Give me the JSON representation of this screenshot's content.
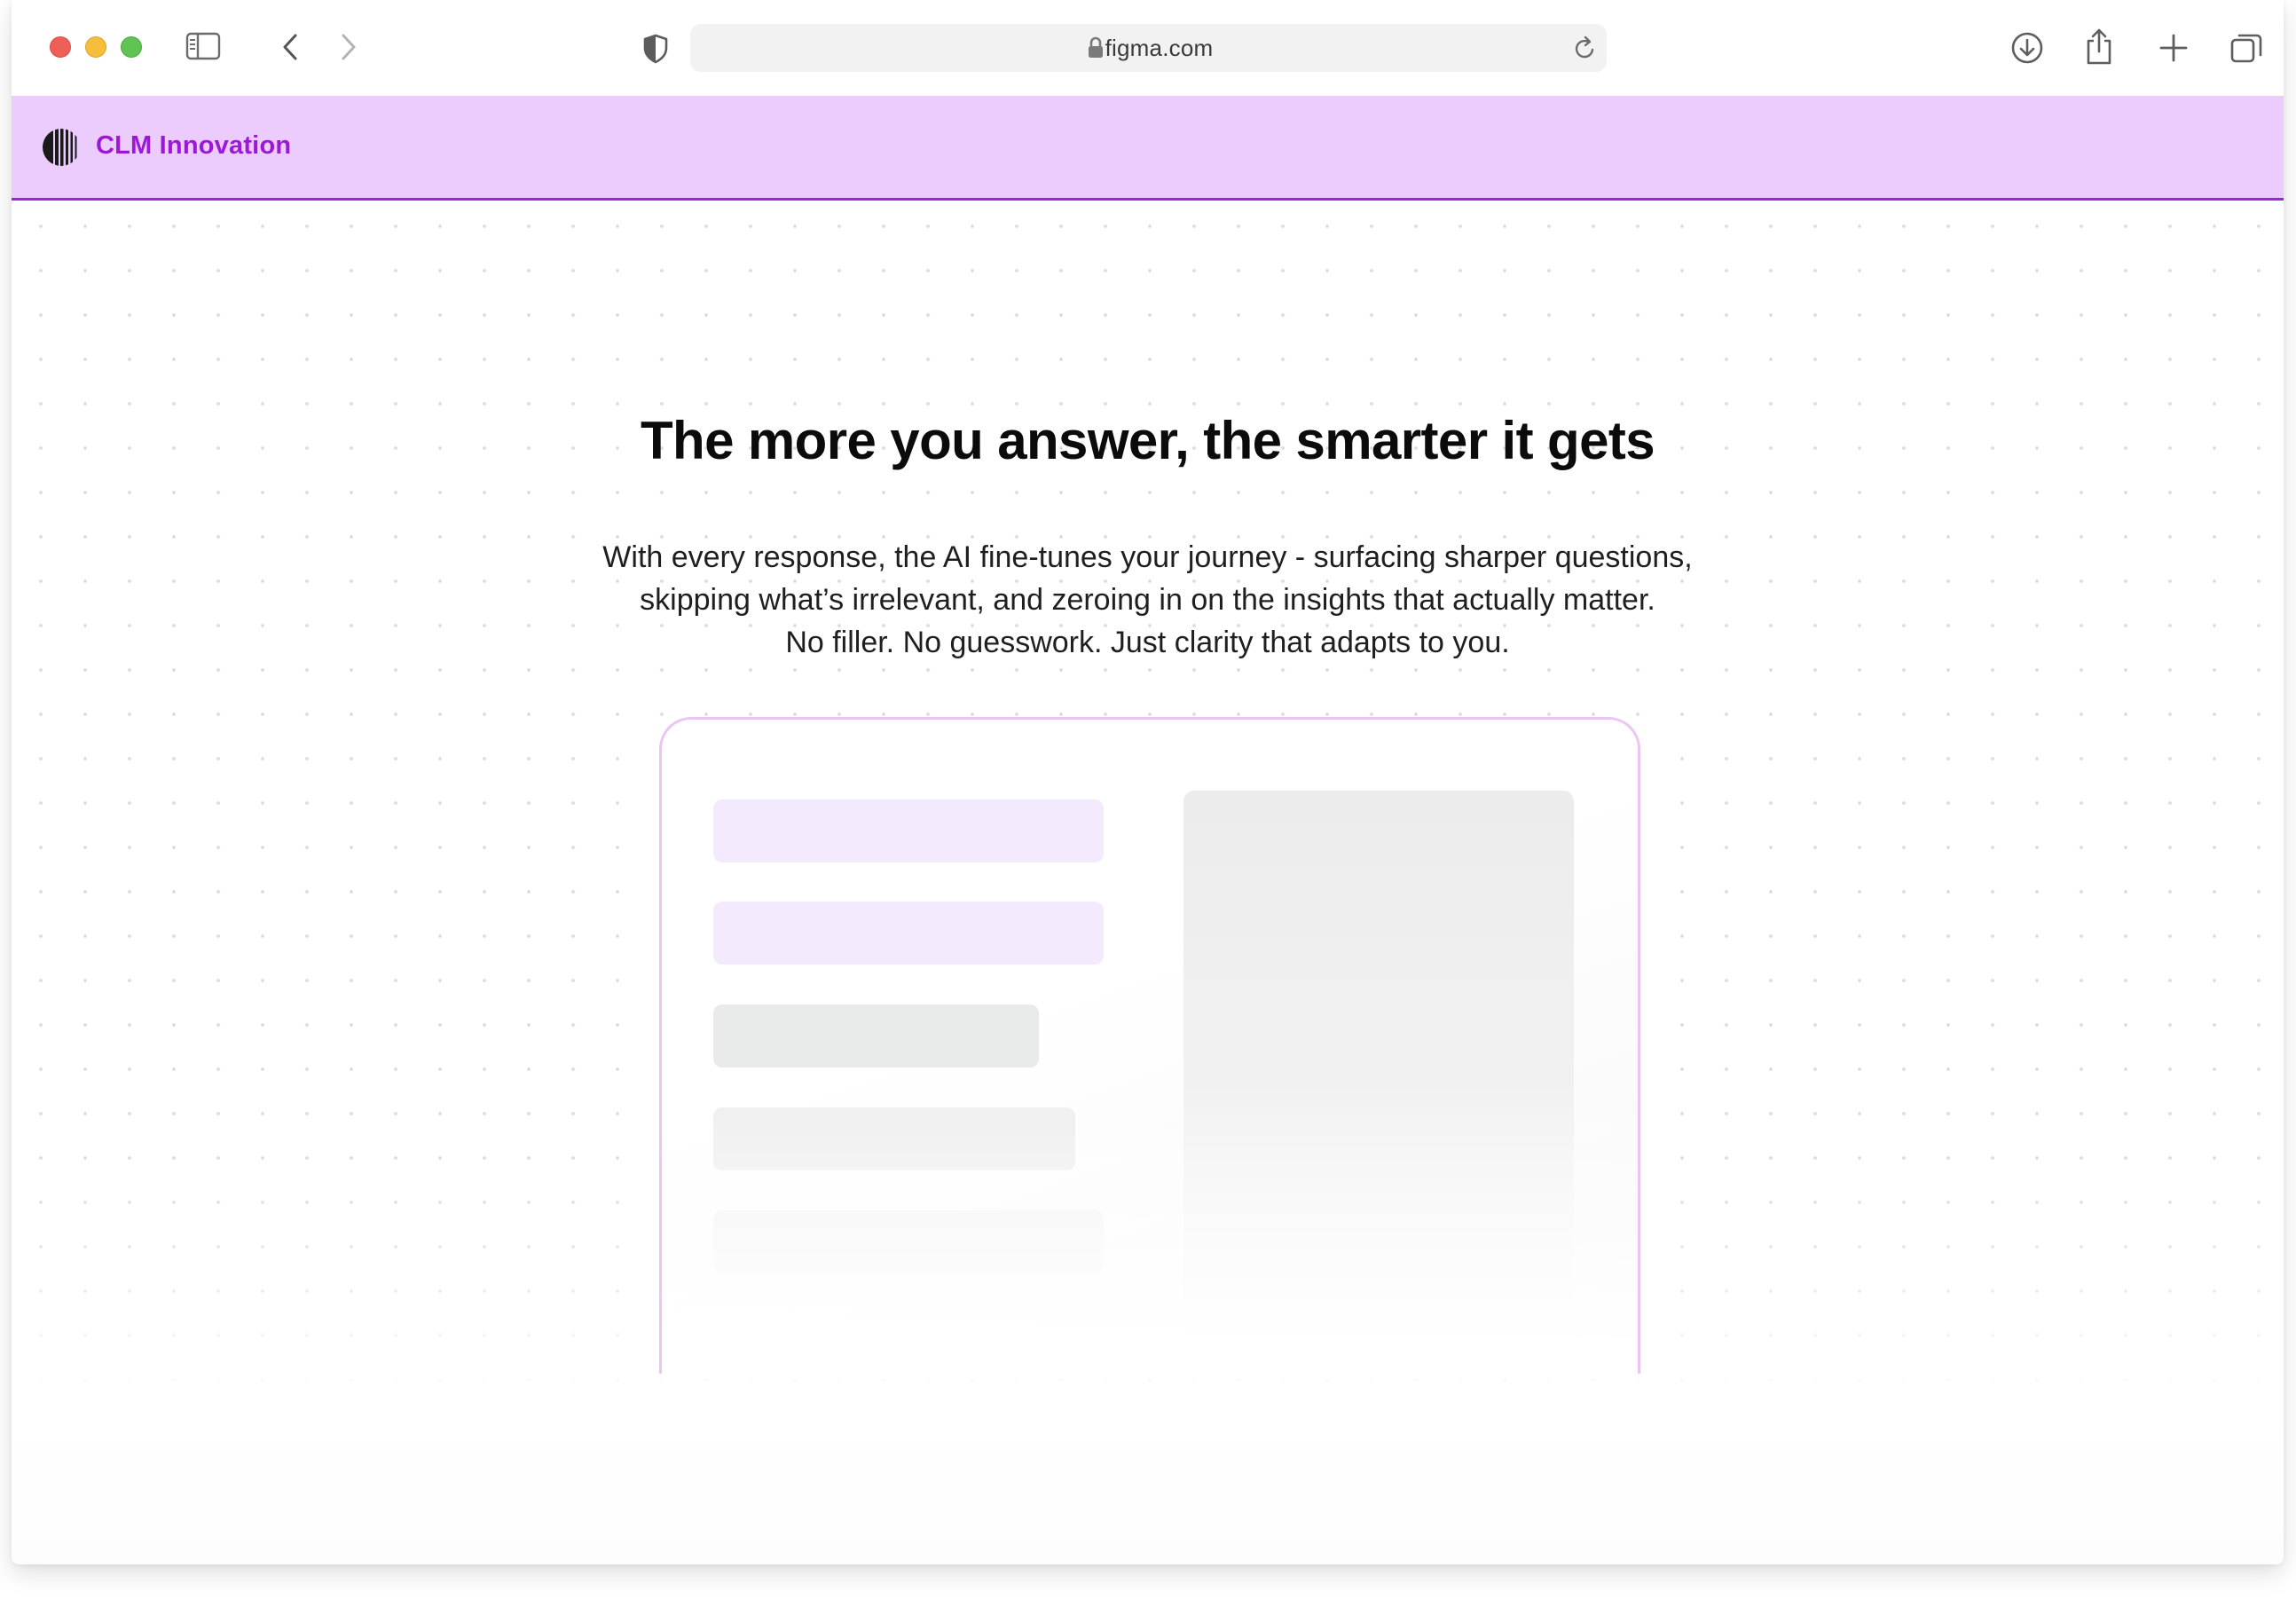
{
  "browser": {
    "url": "figma.com",
    "icons": [
      "sidebar-icon",
      "back-icon",
      "forward-icon",
      "shield-icon",
      "lock-icon",
      "reload-icon",
      "download-icon",
      "share-icon",
      "new-tab-icon",
      "tab-overview-icon"
    ]
  },
  "app": {
    "brand": "CLM Innovation",
    "accent_color": "#9b18d4",
    "bar_color": "#eccbfd"
  },
  "hero": {
    "title": "The more you answer, the smarter it gets",
    "lines": [
      "With every response, the AI fine-tunes your journey - surfacing sharper questions,",
      "skipping what’s irrelevant, and zeroing in on the insights that actually matter.",
      "No filler. No guesswork. Just clarity that adapts to you."
    ]
  }
}
